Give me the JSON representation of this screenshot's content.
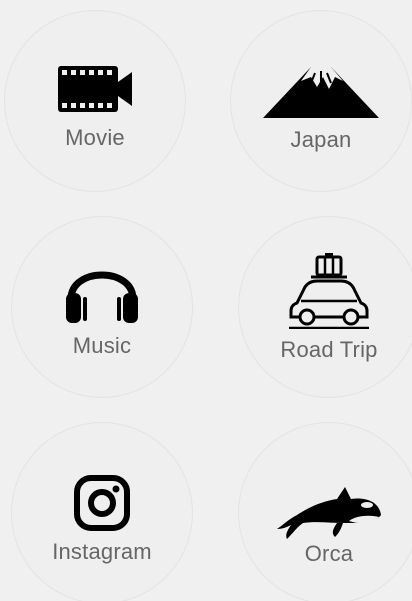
{
  "tiles": [
    {
      "id": "movie",
      "label": "Movie",
      "icon": "video-camera-icon"
    },
    {
      "id": "japan",
      "label": "Japan",
      "icon": "mount-fuji-icon"
    },
    {
      "id": "music",
      "label": "Music",
      "icon": "headphones-icon"
    },
    {
      "id": "road_trip",
      "label": "Road Trip",
      "icon": "car-with-luggage-icon"
    },
    {
      "id": "instagram",
      "label": "Instagram",
      "icon": "instagram-icon"
    },
    {
      "id": "orca",
      "label": "Orca",
      "icon": "orca-icon"
    }
  ],
  "colors": {
    "background": "#f0f0f0",
    "tile_border": "#e3e3e3",
    "label": "#666666",
    "icon": "#000000"
  }
}
